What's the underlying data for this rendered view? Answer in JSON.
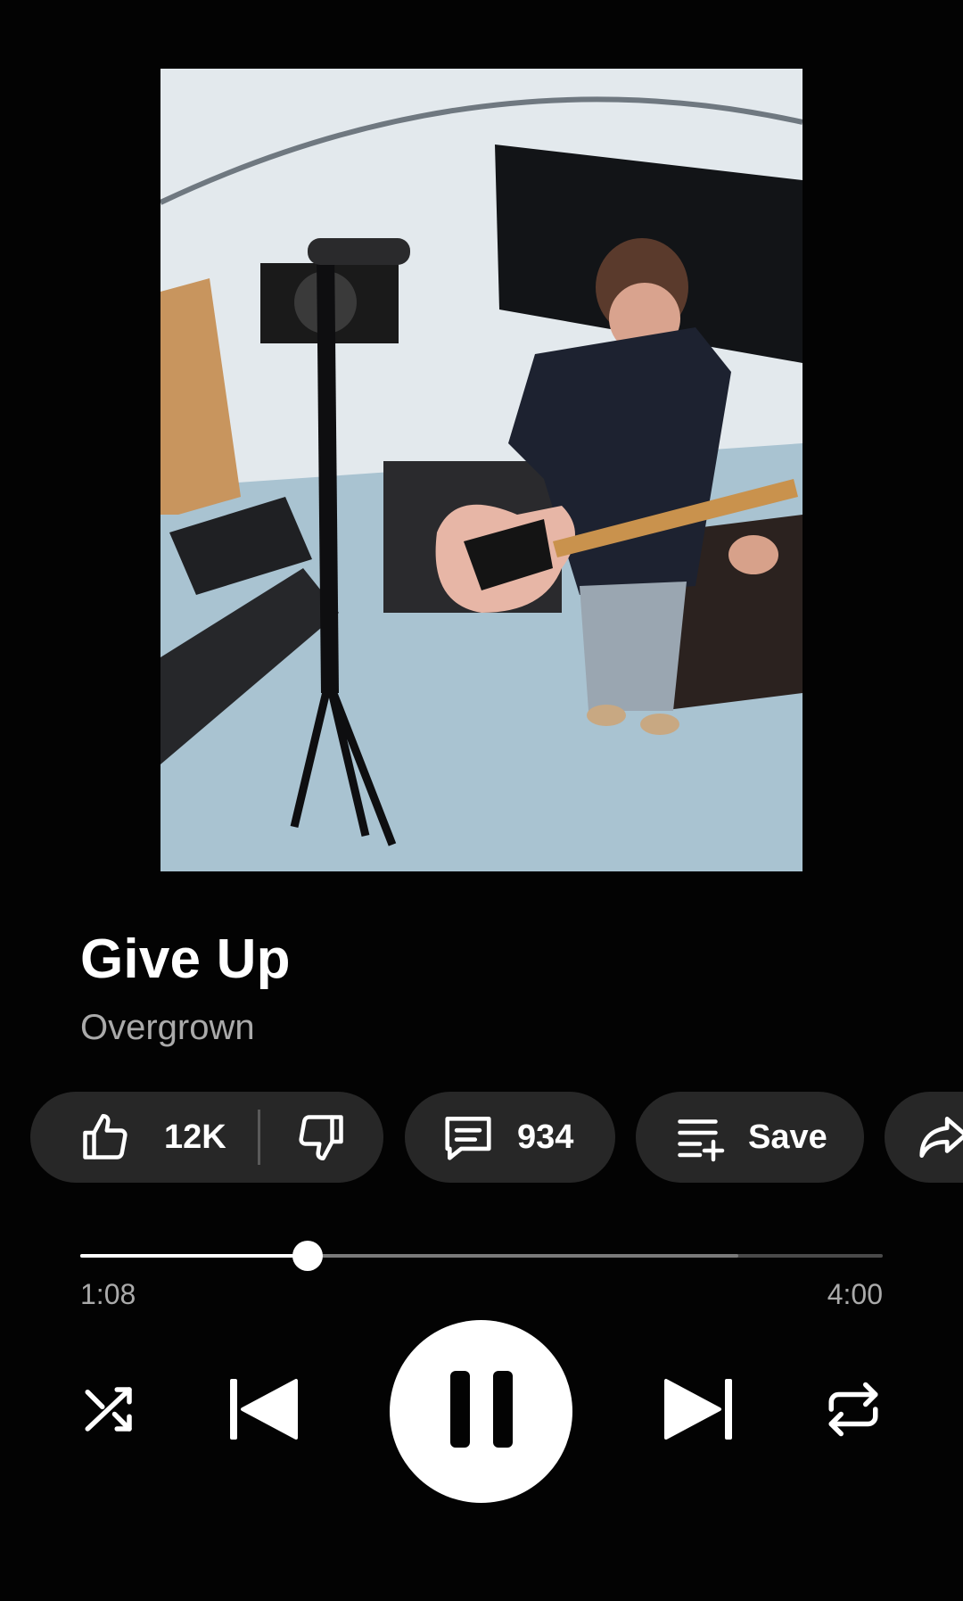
{
  "track": {
    "title": "Give Up",
    "artist": "Overgrown"
  },
  "actions": {
    "likes": "12K",
    "comments": "934",
    "save_label": "Save"
  },
  "playback": {
    "current_time": "1:08",
    "total_time": "4:00",
    "progress": 0.283,
    "buffered": 0.82,
    "state": "playing"
  },
  "icons": {
    "like": "thumbs-up-icon",
    "dislike": "thumbs-down-icon",
    "comment": "comment-icon",
    "save": "playlist-add-icon",
    "share": "share-icon",
    "shuffle": "shuffle-icon",
    "previous": "skip-previous-icon",
    "pause": "pause-icon",
    "next": "skip-next-icon",
    "repeat": "repeat-icon"
  },
  "colors": {
    "background": "#030303",
    "pill": "#272727",
    "secondary_text": "#aaaaaa"
  }
}
